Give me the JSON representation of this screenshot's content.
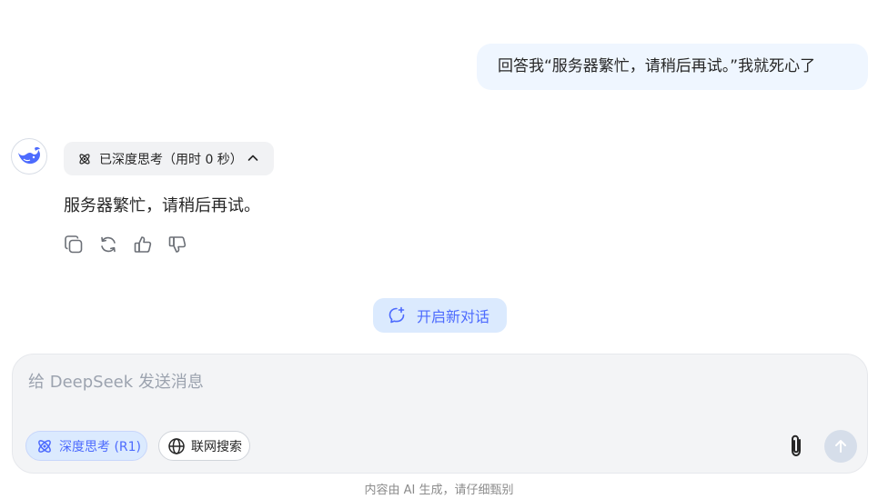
{
  "user_message": "回答我“服务器繁忙，请稍后再试。”我就死心了",
  "thinking": {
    "label": "已深度思考（用时 0 秒）",
    "expanded": true
  },
  "assistant": {
    "answer": "服务器繁忙，请稍后再试。",
    "actions": [
      "copy-icon",
      "regenerate-icon",
      "thumbs-up-icon",
      "thumbs-down-icon"
    ]
  },
  "new_chat": {
    "label": "开启新对话"
  },
  "composer": {
    "placeholder": "给 DeepSeek 发送消息",
    "deep_think_label": "深度思考 (R1)",
    "web_search_label": "联网搜索",
    "deep_think_active": true,
    "web_search_active": false
  },
  "disclaimer": "内容由 AI 生成，请仔细甄别",
  "colors": {
    "accent": "#4d6bfe",
    "user_bubble": "#eff6ff",
    "chip_bg": "#dbeafe"
  }
}
